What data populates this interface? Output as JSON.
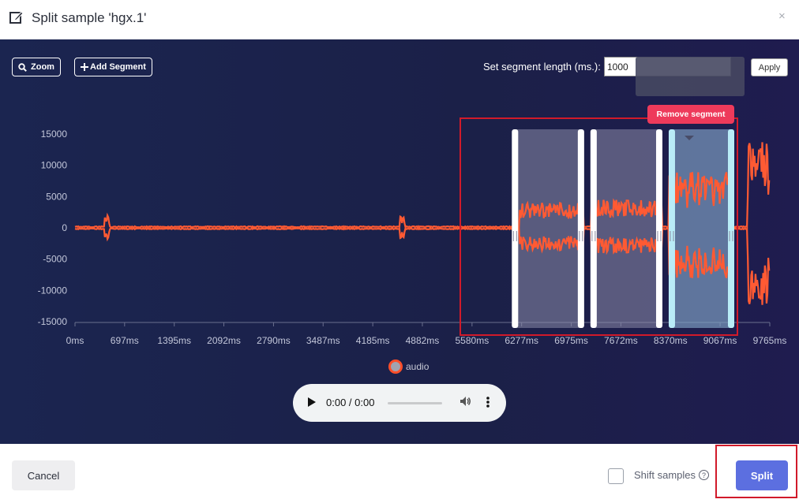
{
  "header": {
    "title": "Split sample 'hgx.1'",
    "close": "×"
  },
  "toolbar": {
    "zoom_label": "Zoom",
    "add_segment_label": "Add Segment",
    "segment_length_label": "Set segment length (ms.):",
    "segment_length_value": "1000",
    "apply_label": "Apply"
  },
  "tooltip": {
    "remove_label": "Remove segment"
  },
  "chart_data": {
    "type": "line",
    "series": [
      {
        "name": "audio",
        "color": "#ff4f2a"
      }
    ],
    "yticks": [
      "15000",
      "10000",
      "5000",
      "0",
      "-5000",
      "-10000",
      "-15000"
    ],
    "ylim": [
      -15000,
      15000
    ],
    "xticks": [
      "0ms",
      "697ms",
      "1395ms",
      "2092ms",
      "2790ms",
      "3487ms",
      "4185ms",
      "4882ms",
      "5580ms",
      "6277ms",
      "6975ms",
      "7672ms",
      "8370ms",
      "9067ms",
      "9765ms"
    ],
    "xlim": [
      0,
      9765
    ],
    "segments": [
      {
        "start_ms": 6140,
        "end_ms": 7200
      },
      {
        "start_ms": 7200,
        "end_ms": 8300
      },
      {
        "start_ms": 8300,
        "end_ms": 9310,
        "selected": true
      }
    ],
    "legend": "audio"
  },
  "player": {
    "time": "0:00 / 0:00"
  },
  "footer": {
    "cancel_label": "Cancel",
    "shift_label": "Shift samples",
    "help": "?",
    "split_label": "Split"
  }
}
